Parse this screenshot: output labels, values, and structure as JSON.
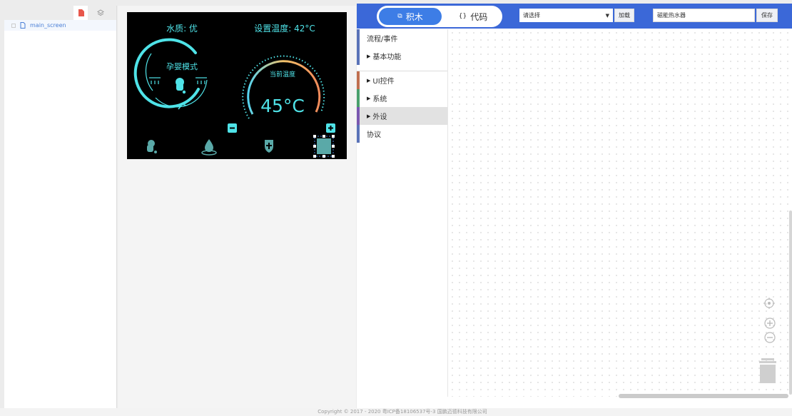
{
  "files": {
    "items": [
      {
        "label": "main_screen"
      }
    ]
  },
  "screen": {
    "water_quality": "水质: 优",
    "set_temp": "设置温度: 42°C",
    "mode_label": "孕婴模式",
    "current_temp_label": "当前温度",
    "current_temp_value": "45°C",
    "colors": {
      "accent": "#4fe3e8",
      "arc_start": "#55d4f0",
      "arc_mid": "#f3c26a",
      "arc_end": "#f08a5a"
    }
  },
  "topbar": {
    "blocks_label": "积木",
    "code_label": "代码",
    "select_placeholder": "请选择",
    "load_label": "加载",
    "project_name": "磁能热水器",
    "save_label": "保存",
    "accent": "#3b68d8"
  },
  "toolbox": {
    "categories": [
      {
        "label": "流程/事件",
        "color": "#5a73b8",
        "expandable": false
      },
      {
        "label": "基本功能",
        "color": "#5a73b8",
        "expandable": true
      },
      {
        "label": "UI控件",
        "color": "#c06f4f",
        "expandable": true
      },
      {
        "label": "系统",
        "color": "#49a06c",
        "expandable": true
      },
      {
        "label": "外设",
        "color": "#7a58b0",
        "expandable": true,
        "selected": true
      },
      {
        "label": "协议",
        "color": "#5a73b8",
        "expandable": false
      }
    ]
  },
  "footer": {
    "text": "Copyright © 2017 - 2020 粤ICP备18106537号-3 国鹏迈德科技有限公司"
  }
}
